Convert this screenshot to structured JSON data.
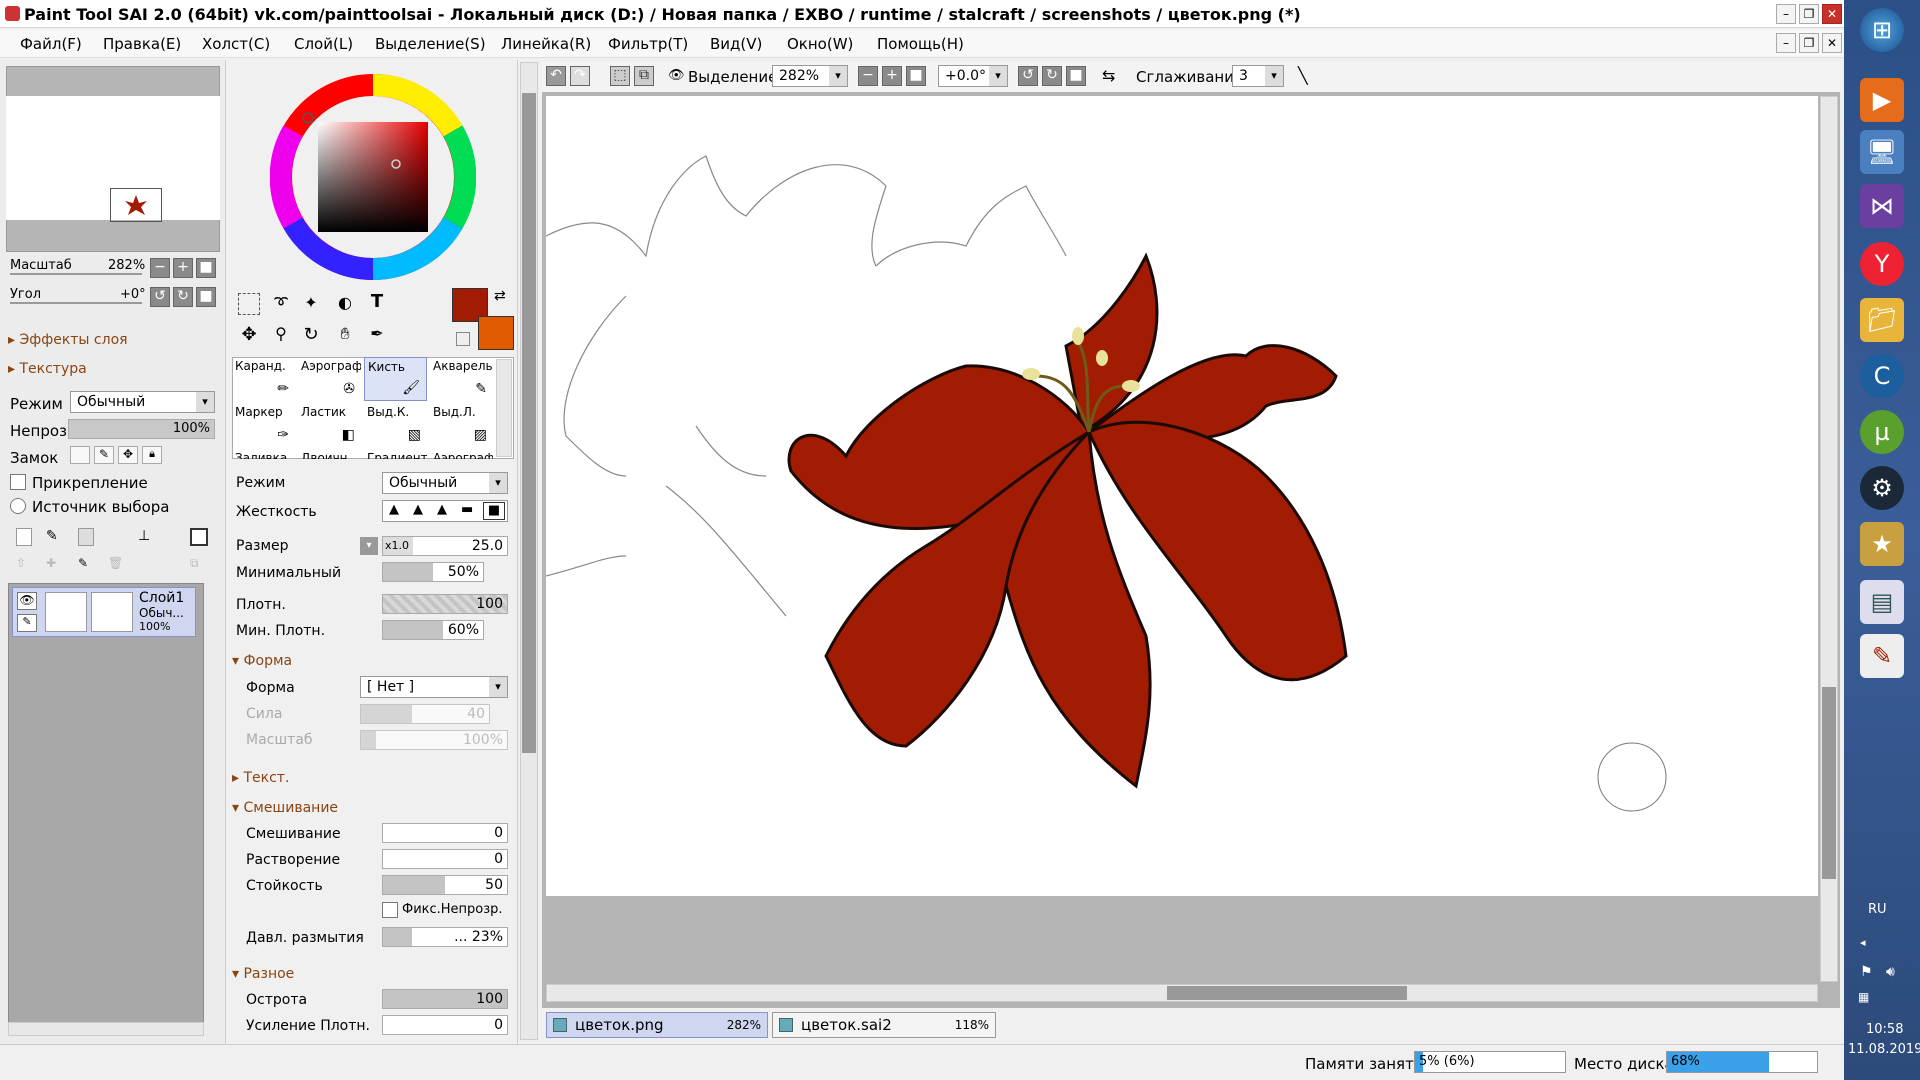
{
  "window": {
    "title": "Paint Tool SAI 2.0 (64bit) vk.com/painttoolsai - Локальный диск (D:) / Новая папка / EXBO / runtime / stalcraft / screenshots / цветок.png (*)"
  },
  "menu": [
    "Файл(F)",
    "Правка(E)",
    "Холст(C)",
    "Слой(L)",
    "Выделение(S)",
    "Линейка(R)",
    "Фильтр(T)",
    "Вид(V)",
    "Окно(W)",
    "Помощь(H)"
  ],
  "navigator": {
    "zoom_label": "Масштаб",
    "zoom_value": "282%",
    "angle_label": "Угол",
    "angle_value": "+0°"
  },
  "layer_panel": {
    "effects": "Эффекты слоя",
    "texture": "Текстура",
    "mode_label": "Режим",
    "mode_value": "Обычный",
    "opacity_label": "Непроз.",
    "opacity_value": "100%",
    "opacity_fraction": 1.0,
    "lock_label": "Замок",
    "clip_label": "Прикрепление",
    "source_label": "Источник выбора",
    "layer": {
      "name": "Слой1",
      "mode": "Обыч...",
      "opacity": "100%"
    }
  },
  "tools": [
    [
      "Каранд.",
      "Аэрограф",
      "Кисть",
      "Акварель"
    ],
    [
      "Маркер",
      "Ластик",
      "Выд.К.",
      "Выд.Л."
    ],
    [
      "Заливка",
      "Двоичн.",
      "Градиент",
      "Аэрограф"
    ]
  ],
  "selected_tool": "Кисть",
  "colors": {
    "primary": "#a21c03",
    "secondary": "#e05a00",
    "accent": "#0078d7"
  },
  "brush": {
    "mode_label": "Режим",
    "mode_value": "Обычный",
    "hardness_label": "Жесткость",
    "size_label": "Размер",
    "size_mult": "x1.0",
    "size_value": "25.0",
    "min_label": "Минимальный",
    "min_value": "50%",
    "min_fraction": 0.5,
    "density_label": "Плотн.",
    "density_value": "100",
    "density_fraction": 1.0,
    "min_density_label": "Мин. Плотн.",
    "min_density_value": "60%",
    "min_density_fraction": 0.6,
    "shape_section": "Форма",
    "shape_label": "Форма",
    "shape_value": "[ Нет ]",
    "strength_label": "Сила",
    "strength_value": "40",
    "strength_fraction": 0.4,
    "scale_label": "Масштаб",
    "scale_value": "100%",
    "scale_fraction": 0.1,
    "text_section": "Текст.",
    "blend_section": "Смешивание",
    "blend_label": "Смешивание",
    "blend_value": "0",
    "dilution_label": "Растворение",
    "dilution_value": "0",
    "persist_label": "Стойкость",
    "persist_value": "50",
    "persist_fraction": 0.5,
    "keep_opacity_label": "Фикс.Непрозр.",
    "blur_label": "Давл. размытия",
    "blur_value": "... 23%",
    "blur_fraction": 0.23,
    "misc_section": "Разное",
    "sharp_label": "Острота",
    "sharp_value": "100",
    "sharp_fraction": 1.0,
    "dens_boost_label": "Усиление Плотн.",
    "dens_boost_value": "0"
  },
  "toolbar": {
    "selection_label": "Выделение",
    "zoom": "282%",
    "angle": "+0.0°",
    "stab_label": "Сглаживание",
    "stab_value": "3"
  },
  "tabs": [
    {
      "name": "цветок.png",
      "zoom": "282%"
    },
    {
      "name": "цветок.sai2",
      "zoom": "118%"
    }
  ],
  "status": {
    "mem_label": "Памяти занято",
    "mem_value": "5% (6%)",
    "mem_fraction": 0.05,
    "disk_label": "Место диска",
    "disk_value": "68%",
    "disk_fraction": 0.68
  },
  "system": {
    "lang": "RU",
    "time": "10:58",
    "date": "11.08.2019"
  }
}
